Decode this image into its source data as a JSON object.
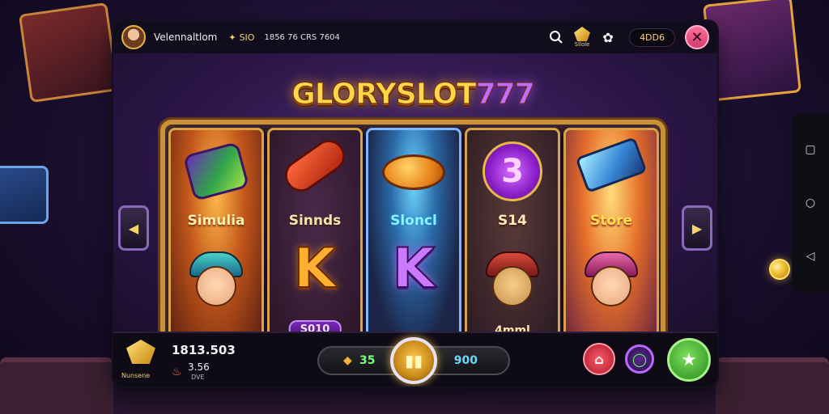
{
  "header": {
    "username": "Velennaltlom",
    "coins": "SIO",
    "stats": "1856 76 CRS 7604",
    "shop_label": "Sllole",
    "balance": "4DD6",
    "icons": {
      "search": "search-icon",
      "settings": "gear-icon",
      "close": "close-icon"
    }
  },
  "logo": {
    "text": "GLORYSLOT",
    "number": "777"
  },
  "reels": [
    {
      "label": "Simulia",
      "tag": ""
    },
    {
      "label": "Sinnds",
      "tag": "S010"
    },
    {
      "label": "Sloncl",
      "tag": ""
    },
    {
      "label": "S14",
      "tag": "4mml"
    },
    {
      "label": "Store",
      "tag": ""
    }
  ],
  "big_letter": "K",
  "symbol_three": "3",
  "arrows": {
    "left": "◀",
    "right": "▶"
  },
  "footer": {
    "gem_label": "Nunsene",
    "total": "1813.503",
    "win": "3.56",
    "win_sub": "DVE",
    "bet_left": "35",
    "bet_right": "900",
    "spin_icon": "▮▮"
  },
  "colors": {
    "accent_gold": "#f1c232",
    "accent_purple": "#b86aff",
    "close_pink": "#ff6f9a"
  }
}
